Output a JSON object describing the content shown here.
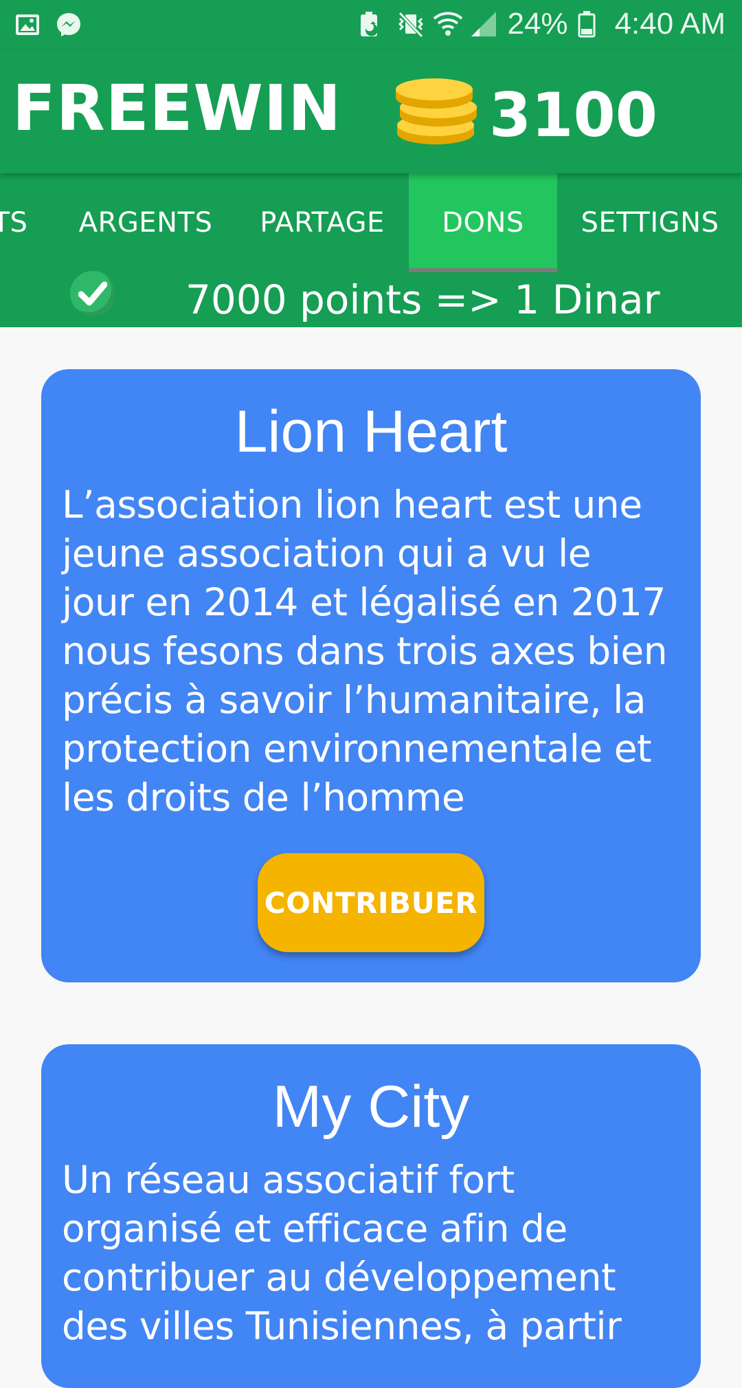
{
  "status_bar": {
    "battery": "24%",
    "time": "4:40 AM",
    "icons_left": [
      "image-icon",
      "messenger-icon"
    ],
    "icons_right": [
      "battery-saver-icon",
      "vibrate-mute-icon",
      "wifi-icon",
      "signal-icon",
      "battery-icon"
    ]
  },
  "app": {
    "title": "FREEWIN",
    "coins": "3100",
    "coins_icon": "coins-stack-icon"
  },
  "tabs": [
    {
      "label": "TS"
    },
    {
      "label": "ARGENTS"
    },
    {
      "label": "PARTAGE"
    },
    {
      "label": "DONS",
      "active": true
    },
    {
      "label": "SETTIGNS"
    }
  ],
  "rate": {
    "text": "7000 points => 1 Dinar"
  },
  "cards": [
    {
      "title": "Lion Heart",
      "description_lines": [
        "L’association lion heart est une",
        "jeune association qui a vu le",
        "jour en 2014 et légalisé en 2017",
        "nous fesons dans trois axes bien",
        "précis à savoir l’humanitaire, la",
        "protection environnementale et",
        "les droits de l’homme"
      ],
      "button": "CONTRIBUER"
    },
    {
      "title": "My City",
      "description_lines": [
        "Un réseau associatif fort",
        "organisé et efficace afin de",
        "contribuer au développement",
        "des villes Tunisiennes, à partir"
      ]
    }
  ],
  "colors": {
    "primary": "#169e54",
    "tab_active": "#22c55e",
    "card": "#4285f4",
    "button": "#f4b400"
  }
}
